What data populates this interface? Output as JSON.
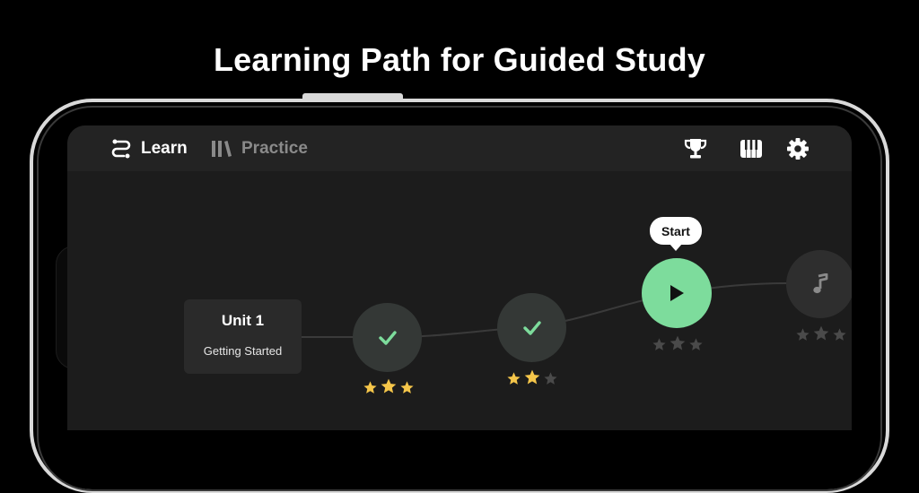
{
  "headline": "Learning Path for Guided Study",
  "nav": {
    "learn_label": "Learn",
    "practice_label": "Practice",
    "active_tab": "Learn",
    "icons": [
      "path-icon",
      "library-icon",
      "trophy-icon",
      "piano-icon",
      "gear-icon"
    ]
  },
  "unit": {
    "title": "Unit 1",
    "subtitle": "Getting Started"
  },
  "lessons": [
    {
      "state": "completed",
      "icon": "checkmark-icon",
      "stars_earned": 3,
      "stars_total": 3
    },
    {
      "state": "completed",
      "icon": "checkmark-icon",
      "stars_earned": 2,
      "stars_total": 3
    },
    {
      "state": "current",
      "icon": "play-icon",
      "stars_earned": 0,
      "stars_total": 3,
      "tooltip": "Start"
    },
    {
      "state": "locked",
      "icon": "music-note-icon",
      "stars_earned": 0,
      "stars_total": 3
    }
  ],
  "colors": {
    "background": "#000000",
    "screen": "#1c1c1c",
    "nav_bar": "#232323",
    "accent_green": "#7ddc9c",
    "check_green": "#7ddc9c",
    "star_gold": "#f5c64a",
    "star_empty": "#4a4a4a",
    "inactive_text": "#8a8a8a"
  }
}
